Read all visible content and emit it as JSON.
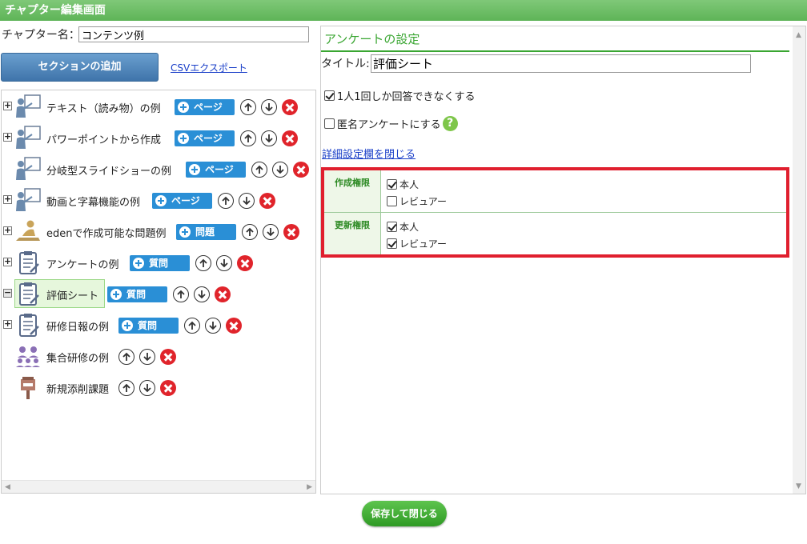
{
  "window": {
    "title": "チャプター編集画面"
  },
  "chapter": {
    "label": "チャプター名：",
    "value": "コンテンツ例"
  },
  "toolbar": {
    "add_section": "セクションの追加",
    "csv_export": "CSVエクスポート"
  },
  "tree": {
    "items": [
      {
        "label": "テキスト（読み物）の例",
        "button": "ページ",
        "icon": "presentation-icon"
      },
      {
        "label": "パワーポイントから作成",
        "button": "ページ",
        "icon": "presentation-icon"
      },
      {
        "label": "分岐型スライドショーの例",
        "button": "ページ",
        "icon": "presentation-icon"
      },
      {
        "label": "動画と字幕機能の例",
        "button": "ページ",
        "icon": "presentation-icon"
      },
      {
        "label": "edenで作成可能な問題例",
        "button": "問題",
        "icon": "writing-person-icon"
      },
      {
        "label": "アンケートの例",
        "button": "質問",
        "icon": "clipboard-icon"
      },
      {
        "label": "評価シート",
        "button": "質問",
        "icon": "clipboard-icon"
      },
      {
        "label": "研修日報の例",
        "button": "質問",
        "icon": "clipboard-icon"
      },
      {
        "label": "集合研修の例",
        "button": "",
        "icon": "group-icon"
      },
      {
        "label": "新規添削課題",
        "button": "",
        "icon": "postbox-icon"
      }
    ]
  },
  "survey": {
    "heading": "アンケートの設定",
    "title_label": "タイトル:",
    "title_value": "評価シート",
    "once_only": "1人1回しか回答できなくする",
    "anonymous": "匿名アンケートにする",
    "help": "?",
    "detail_link": "詳細設定欄を閉じる",
    "permissions": [
      {
        "heading": "作成権限",
        "options": [
          {
            "label": "本人",
            "checked": true
          },
          {
            "label": "レビュアー",
            "checked": false
          }
        ]
      },
      {
        "heading": "更新権限",
        "options": [
          {
            "label": "本人",
            "checked": true
          },
          {
            "label": "レビュアー",
            "checked": true
          }
        ]
      }
    ]
  },
  "footer": {
    "save_close": "保存して閉じる"
  },
  "colors": {
    "accent_green": "#3aa632",
    "button_blue": "#2a8fd6",
    "highlight_red": "#e01f2e"
  }
}
